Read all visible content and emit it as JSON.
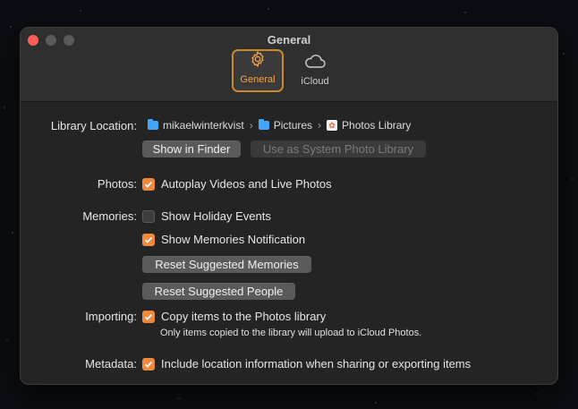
{
  "window": {
    "title": "General",
    "tabs": [
      {
        "label": "General",
        "icon": "gear-icon",
        "active": true
      },
      {
        "label": "iCloud",
        "icon": "cloud-icon",
        "active": false
      }
    ]
  },
  "library": {
    "label": "Library Location:",
    "path": [
      "mikaelwinterkvist",
      "Pictures",
      "Photos Library"
    ],
    "path_separator": "›",
    "show_in_finder": "Show in Finder",
    "use_as_system": "Use as System Photo Library"
  },
  "photos": {
    "label": "Photos:",
    "autoplay": {
      "text": "Autoplay Videos and Live Photos",
      "checked": true
    }
  },
  "memories": {
    "label": "Memories:",
    "holiday": {
      "text": "Show Holiday Events",
      "checked": false
    },
    "notification": {
      "text": "Show Memories Notification",
      "checked": true
    },
    "reset_memories": "Reset Suggested Memories",
    "reset_people": "Reset Suggested People"
  },
  "importing": {
    "label": "Importing:",
    "copy": {
      "text": "Copy items to the Photos library",
      "checked": true
    },
    "note": "Only items copied to the library will upload to iCloud Photos."
  },
  "metadata": {
    "label": "Metadata:",
    "location": {
      "text": "Include location information when sharing or exporting items",
      "checked": true
    }
  },
  "colors": {
    "accent": "#f0883e",
    "active_tab_border": "#c98a2e"
  }
}
